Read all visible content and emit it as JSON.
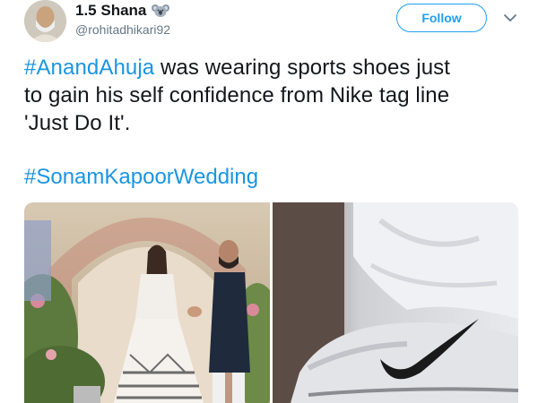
{
  "tweet": {
    "display_name": "1.5 Shana",
    "handle": "@rohitadhikari92",
    "follow_label": "Follow",
    "text_hashtag_1": "#AnandAhuja",
    "text_line_1_rest": " was wearing sports shoes just",
    "text_line_2": "to gain his self confidence from Nike tag line",
    "text_line_3": "'Just Do It'.",
    "hashtag_2": "#SonamKapoorWedding"
  },
  "colors": {
    "accent": "#1da1f2",
    "hashtag": "#1b95e0",
    "text": "#14171a",
    "secondary": "#657786"
  },
  "icons": {
    "name_badge": "koala-icon",
    "menu": "chevron-down-icon"
  }
}
